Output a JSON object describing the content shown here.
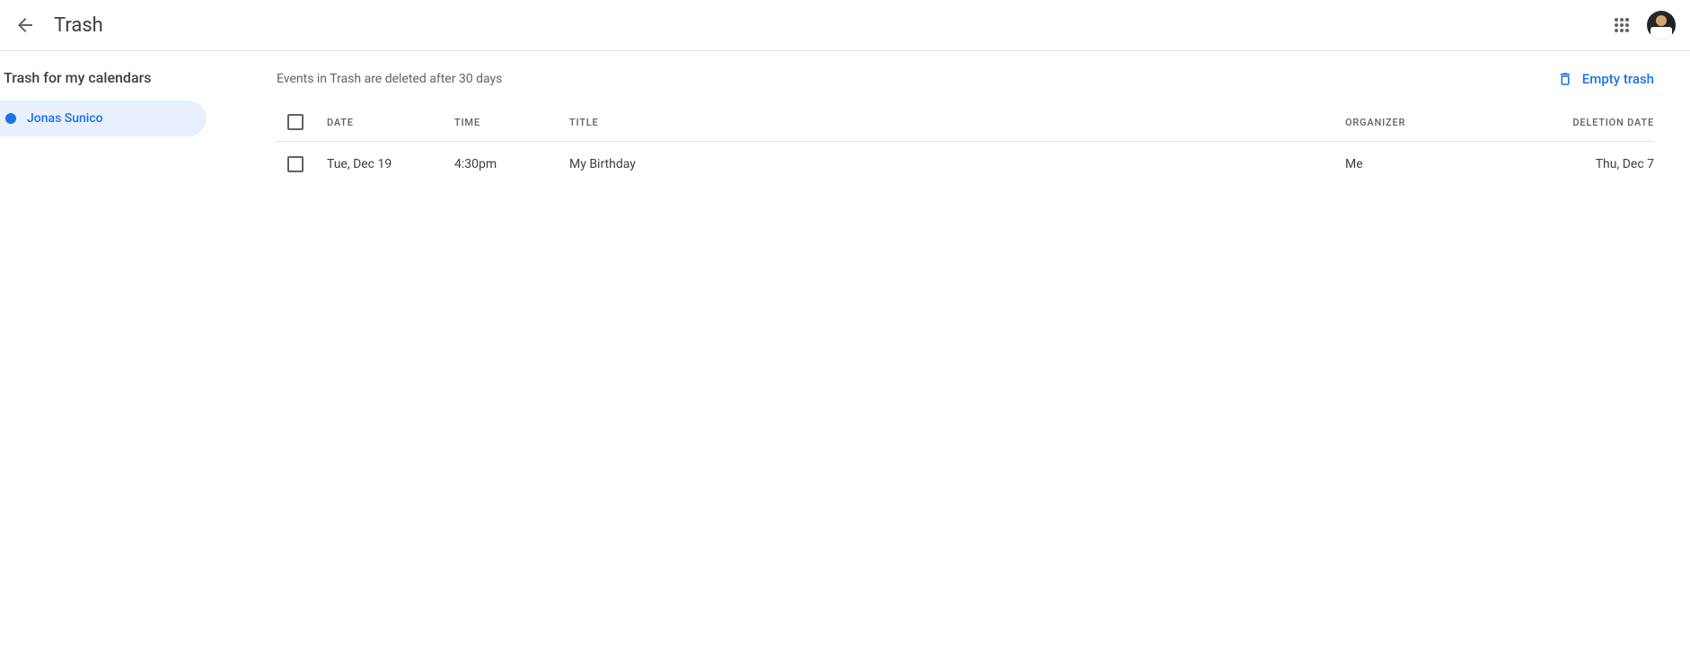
{
  "header": {
    "title": "Trash"
  },
  "sidebar": {
    "title": "Trash for my calendars",
    "items": [
      {
        "label": "Jonas Sunico",
        "color": "#1a73e8",
        "active": true
      }
    ]
  },
  "main": {
    "info_text": "Events in Trash are deleted after 30 days",
    "empty_trash_label": "Empty trash",
    "columns": {
      "date": "DATE",
      "time": "TIME",
      "title": "TITLE",
      "organizer": "ORGANIZER",
      "deletion_date": "DELETION DATE"
    },
    "rows": [
      {
        "date": "Tue, Dec 19",
        "time": "4:30pm",
        "title": "My Birthday",
        "organizer": "Me",
        "deletion_date": "Thu, Dec 7"
      }
    ]
  }
}
